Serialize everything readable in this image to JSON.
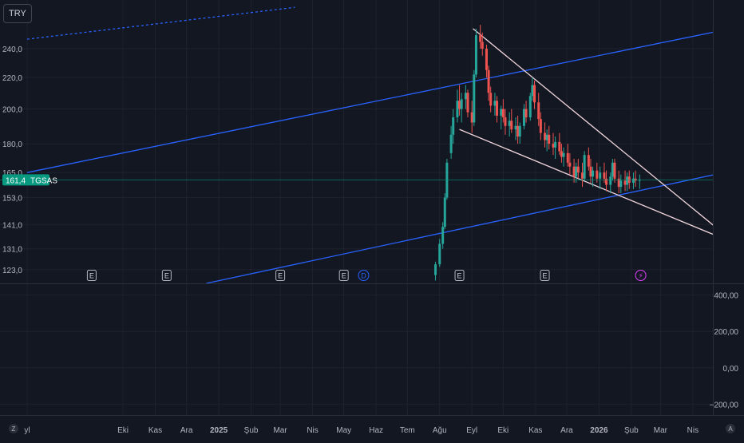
{
  "currency": "TRY",
  "symbol": "TGSAS",
  "last_price_label": "161,4",
  "colors": {
    "background": "#131722",
    "grid": "#1e222d",
    "up": "#26a69a",
    "down": "#ef5350",
    "channel": "#2962ff",
    "wedge": "#f0d5dc",
    "price_tag": "#089981",
    "axis_text": "#b2b5be"
  },
  "event_markers": [
    {
      "type": "earnings",
      "label": "E",
      "date": "2024-09-01"
    },
    {
      "type": "earnings",
      "label": "E",
      "date": "2024-11-12"
    },
    {
      "type": "earnings",
      "label": "E",
      "date": "2025-03-01"
    },
    {
      "type": "earnings",
      "label": "E",
      "date": "2025-05-01"
    },
    {
      "type": "dividend",
      "label": "D",
      "date": "2025-05-20"
    },
    {
      "type": "earnings",
      "label": "E",
      "date": "2025-08-20"
    },
    {
      "type": "earnings",
      "label": "E",
      "date": "2025-11-10"
    },
    {
      "type": "split",
      "label": "⚡",
      "date": "2026-02-10"
    }
  ],
  "chart_data": [
    {
      "type": "candlestick",
      "title": "",
      "currency": "TRY",
      "y_scale": "log",
      "ylim": [
        118,
        265
      ],
      "y_ticks": [
        {
          "value": 123,
          "label": "123,0"
        },
        {
          "value": 131,
          "label": "131,0"
        },
        {
          "value": 141,
          "label": "141,0"
        },
        {
          "value": 153,
          "label": "153,0"
        },
        {
          "value": 165,
          "label": "165,0"
        },
        {
          "value": 180,
          "label": "180,0"
        },
        {
          "value": 200,
          "label": "200,0"
        },
        {
          "value": 220,
          "label": "220,0"
        },
        {
          "value": 240,
          "label": "240,0"
        }
      ],
      "x_ticks": [
        {
          "date": "2024-07-01",
          "label": "yl",
          "bold": false
        },
        {
          "date": "2024-10-01",
          "label": "Eki",
          "bold": false
        },
        {
          "date": "2024-11-01",
          "label": "Kas",
          "bold": false
        },
        {
          "date": "2024-12-01",
          "label": "Ara",
          "bold": false
        },
        {
          "date": "2025-01-01",
          "label": "2025",
          "bold": true
        },
        {
          "date": "2025-02-01",
          "label": "Şub",
          "bold": false
        },
        {
          "date": "2025-03-01",
          "label": "Mar",
          "bold": false
        },
        {
          "date": "2025-04-01",
          "label": "Nis",
          "bold": false
        },
        {
          "date": "2025-05-01",
          "label": "May",
          "bold": false
        },
        {
          "date": "2025-06-01",
          "label": "Haz",
          "bold": false
        },
        {
          "date": "2025-07-01",
          "label": "Tem",
          "bold": false
        },
        {
          "date": "2025-08-01",
          "label": "Ağu",
          "bold": false
        },
        {
          "date": "2025-09-01",
          "label": "Eyl",
          "bold": false
        },
        {
          "date": "2025-10-01",
          "label": "Eki",
          "bold": false
        },
        {
          "date": "2025-11-01",
          "label": "Kas",
          "bold": false
        },
        {
          "date": "2025-12-01",
          "label": "Ara",
          "bold": false
        },
        {
          "date": "2026-01-01",
          "label": "2026",
          "bold": true
        },
        {
          "date": "2026-02-01",
          "label": "Şub",
          "bold": false
        },
        {
          "date": "2026-03-01",
          "label": "Mar",
          "bold": false
        },
        {
          "date": "2026-04-01",
          "label": "Nis",
          "bold": false
        }
      ],
      "last_price": 161.4,
      "series": [
        {
          "name": "TGSAS",
          "ohlc": [
            [
              "2025-07-28",
              121,
              126,
              119,
              125
            ],
            [
              "2025-08-01",
              125,
              135,
              124,
              133
            ],
            [
              "2025-08-04",
              133,
              142,
              131,
              140
            ],
            [
              "2025-08-06",
              140,
              155,
              139,
              153
            ],
            [
              "2025-08-08",
              153,
              172,
              152,
              170
            ],
            [
              "2025-08-12",
              175,
              190,
              172,
              185
            ],
            [
              "2025-08-14",
              185,
              200,
              180,
              195
            ],
            [
              "2025-08-18",
              195,
              212,
              192,
              205
            ],
            [
              "2025-08-20",
              205,
              215,
              196,
              200
            ],
            [
              "2025-08-22",
              200,
              210,
              192,
              206
            ],
            [
              "2025-08-26",
              206,
              215,
              200,
              210
            ],
            [
              "2025-08-28",
              210,
              212,
              195,
              198
            ],
            [
              "2025-09-01",
              198,
              205,
              186,
              192
            ],
            [
              "2025-09-03",
              192,
              225,
              190,
              222
            ],
            [
              "2025-09-05",
              222,
              255,
              220,
              250
            ],
            [
              "2025-09-09",
              250,
              258,
              240,
              245
            ],
            [
              "2025-09-11",
              245,
              252,
              235,
              240
            ],
            [
              "2025-09-15",
              240,
              243,
              220,
              225
            ],
            [
              "2025-09-17",
              225,
              228,
              205,
              210
            ],
            [
              "2025-09-19",
              210,
              214,
              198,
              202
            ],
            [
              "2025-09-23",
              202,
              210,
              196,
              205
            ],
            [
              "2025-09-25",
              205,
              208,
              192,
              196
            ],
            [
              "2025-09-29",
              196,
              202,
              188,
              200
            ],
            [
              "2025-10-01",
              200,
              206,
              192,
              195
            ],
            [
              "2025-10-03",
              195,
              200,
              185,
              190
            ],
            [
              "2025-10-07",
              190,
              198,
              184,
              193
            ],
            [
              "2025-10-09",
              193,
              200,
              186,
              188
            ],
            [
              "2025-10-13",
              188,
              195,
              182,
              190
            ],
            [
              "2025-10-15",
              190,
              196,
              180,
              184
            ],
            [
              "2025-10-17",
              184,
              192,
              180,
              190
            ],
            [
              "2025-10-21",
              190,
              203,
              188,
              200
            ],
            [
              "2025-10-23",
              200,
              205,
              192,
              195
            ],
            [
              "2025-10-27",
              195,
              210,
              193,
              208
            ],
            [
              "2025-10-29",
              208,
              220,
              205,
              215
            ],
            [
              "2025-10-31",
              215,
              218,
              200,
              204
            ],
            [
              "2025-11-04",
              204,
              210,
              190,
              194
            ],
            [
              "2025-11-06",
              194,
              198,
              182,
              186
            ],
            [
              "2025-11-10",
              186,
              192,
              178,
              182
            ],
            [
              "2025-11-12",
              182,
              188,
              176,
              185
            ],
            [
              "2025-11-14",
              185,
              190,
              177,
              180
            ],
            [
              "2025-11-18",
              180,
              186,
              174,
              178
            ],
            [
              "2025-11-20",
              178,
              184,
              172,
              181
            ],
            [
              "2025-11-24",
              181,
              186,
              174,
              176
            ],
            [
              "2025-11-26",
              176,
              180,
              170,
              173
            ],
            [
              "2025-11-28",
              173,
              178,
              168,
              175
            ],
            [
              "2025-12-02",
              175,
              180,
              168,
              170
            ],
            [
              "2025-12-04",
              170,
              175,
              164,
              168
            ],
            [
              "2025-12-08",
              168,
              172,
              160,
              163
            ],
            [
              "2025-12-10",
              163,
              170,
              160,
              168
            ],
            [
              "2025-12-12",
              168,
              172,
              162,
              165
            ],
            [
              "2025-12-16",
              165,
              170,
              158,
              162
            ],
            [
              "2025-12-18",
              162,
              176,
              161,
              174
            ],
            [
              "2025-12-22",
              174,
              178,
              166,
              168
            ],
            [
              "2025-12-24",
              168,
              172,
              160,
              163
            ],
            [
              "2025-12-26",
              163,
              168,
              158,
              166
            ],
            [
              "2025-12-30",
              166,
              170,
              160,
              162
            ],
            [
              "2026-01-02",
              162,
              168,
              157,
              165
            ],
            [
              "2026-01-06",
              165,
              170,
              160,
              162
            ],
            [
              "2026-01-08",
              162,
              166,
              156,
              159
            ],
            [
              "2026-01-12",
              159,
              165,
              155,
              163
            ],
            [
              "2026-01-14",
              163,
              172,
              161,
              170
            ],
            [
              "2026-01-16",
              170,
              172,
              160,
              162
            ],
            [
              "2026-01-20",
              162,
              166,
              155,
              158
            ],
            [
              "2026-01-22",
              158,
              164,
              155,
              161
            ],
            [
              "2026-01-26",
              161,
              166,
              156,
              159
            ],
            [
              "2026-01-28",
              159,
              165,
              156,
              163
            ],
            [
              "2026-01-30",
              163,
              166,
              157,
              160
            ],
            [
              "2026-02-03",
              160,
              165,
              157,
              162
            ],
            [
              "2026-02-05",
              162,
              166,
              158,
              161
            ],
            [
              "2026-02-09",
              161,
              164,
              157,
              161.4
            ]
          ]
        }
      ],
      "trend_lines": [
        {
          "name": "channel-upper",
          "points": [
            [
              "2024-07-01",
              165
            ],
            [
              "2026-05-01",
              254
            ]
          ],
          "style": "solid"
        },
        {
          "name": "channel-lower",
          "points": [
            [
              "2024-12-20",
              118
            ],
            [
              "2026-05-01",
              165
            ]
          ],
          "style": "solid"
        },
        {
          "name": "channel-top-dashed",
          "points": [
            [
              "2024-07-01",
              247
            ],
            [
              "2025-03-15",
              272
            ]
          ],
          "style": "dashed"
        },
        {
          "name": "wedge-upper",
          "points": [
            [
              "2025-09-02",
              255
            ],
            [
              "2026-05-01",
              137
            ]
          ],
          "style": "solid"
        },
        {
          "name": "wedge-lower",
          "points": [
            [
              "2025-08-20",
              188
            ],
            [
              "2026-05-01",
              135
            ]
          ],
          "style": "solid"
        }
      ]
    },
    {
      "type": "line",
      "title": "",
      "ylim": [
        -260,
        460
      ],
      "y_ticks": [
        {
          "value": 400,
          "label": "400,00"
        },
        {
          "value": 200,
          "label": "200,00"
        },
        {
          "value": 0,
          "label": "0,00"
        },
        {
          "value": -200,
          "label": "−200,00"
        }
      ],
      "series": []
    }
  ],
  "bottom_bar": {
    "left_icon_label": "Z",
    "right_icon_label": "A"
  }
}
